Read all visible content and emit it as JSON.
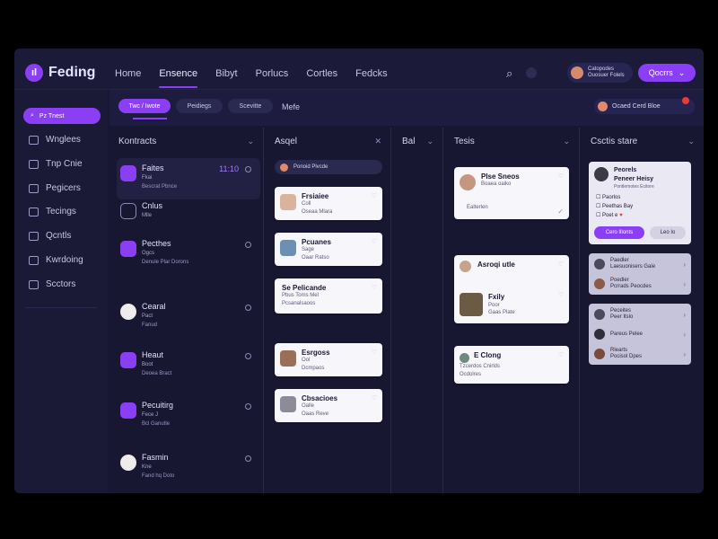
{
  "app": {
    "brand": "Feding",
    "logo_glyph": "ıl"
  },
  "topnav": [
    "Home",
    "Ensence",
    "Bibyt",
    "Porlucs",
    "Cortles",
    "Fedcks"
  ],
  "topnav_active_index": 1,
  "top_user": {
    "line1": "Catopodes",
    "line2": "Ouosuer Folels"
  },
  "top_button": {
    "label": "Qocrrs"
  },
  "sidebar": {
    "search": "Pz Tnest",
    "items": [
      "Wnglees",
      "Tnp Cnie",
      "Pegicers",
      "Tecings",
      "Qcntls",
      "Kwrdoing",
      "Scctors"
    ]
  },
  "toolbar": {
    "tabs": [
      "Twc / Iwote",
      "Peidiegs",
      "Scevitte"
    ],
    "last_tab": "Mefe",
    "user": "Ocaed Cerd Bloe"
  },
  "columns": {
    "contacts": {
      "title": "Kontracts",
      "items": [
        {
          "name": "Faites",
          "sub1": "Fkai",
          "sub2": "Bescrat Pbnce",
          "time": "11:10"
        },
        {
          "name": "Cnlus",
          "sub1": "Mlle",
          "sub2": ""
        },
        {
          "name": "Pecthes",
          "sub1": "Ogcs",
          "sub2": "Denule Plar Dorons"
        },
        {
          "name": "Cearal",
          "sub1": "Pact",
          "sub2": "Fanud"
        },
        {
          "name": "Heaut",
          "sub1": "Boot",
          "sub2": "Deoea Bract"
        },
        {
          "name": "Pecuitirg",
          "sub1": "Fece J",
          "sub2": "Bcl Ganutle"
        },
        {
          "name": "Fasmin",
          "sub1": "Kne",
          "sub2": "Fand hq Doto"
        }
      ]
    },
    "col2": {
      "title": "Asqel",
      "bar": "Ponoid Plvcde",
      "cards": [
        {
          "title": "Frsiaiee",
          "l1": "Coll",
          "l2": "Oseaa Mlara"
        },
        {
          "title": "Pcuanes",
          "l1": "Sage",
          "l2": "Oaar Ratso"
        },
        {
          "title": "Se Pelicande",
          "l1": "Pbus Toms Mel",
          "l2": "Pcsanalsaoos"
        },
        {
          "title": "Esrgoss",
          "l1": "Ool",
          "l2": "Dcmpaos"
        },
        {
          "title": "Cbsacioes",
          "l1": "Oalle",
          "l2": "Oaas Reve"
        }
      ]
    },
    "col3": {
      "title": "Bal"
    },
    "col4": {
      "title": "Tesis",
      "cards": [
        {
          "title": "Plse Sneos",
          "l1": "Boaea oaiko",
          "l2": "Ealterlen"
        },
        {
          "title": "Asroqi utle",
          "l1": "",
          "l2": ""
        },
        {
          "title": "Fxily",
          "l1": "Poor",
          "l2": "Gaas Plate"
        },
        {
          "title": "E Clong",
          "l1": "Tzcerdos Cnirlds",
          "l2": "Ocdolres"
        }
      ]
    },
    "col5": {
      "title": "Csctis stare",
      "profile": {
        "name": "Peorels",
        "role": "Peneer Heisy",
        "sub": "Pontlemotes Ecitore",
        "checks": [
          "Paorlos",
          "Peethas Bay",
          "Poet e"
        ],
        "btn1": "Cero lIlonts",
        "btn2": "Leo Io"
      },
      "group1": [
        {
          "a": "Paedler",
          "b": "Laesuonisers Gale"
        },
        {
          "a": "Poedler",
          "b": "Pcrrads Peocdes"
        }
      ],
      "group2": [
        {
          "a": "Peceites",
          "b": "Peer Itslo"
        },
        {
          "a": "Pareus Pelee",
          "b": ""
        },
        {
          "a": "Rlearts",
          "b": "Pocisol Dpes"
        }
      ]
    }
  },
  "colors": {
    "accent": "#8b3ff5",
    "bg": "#181732",
    "card": "#f7f6fb"
  }
}
